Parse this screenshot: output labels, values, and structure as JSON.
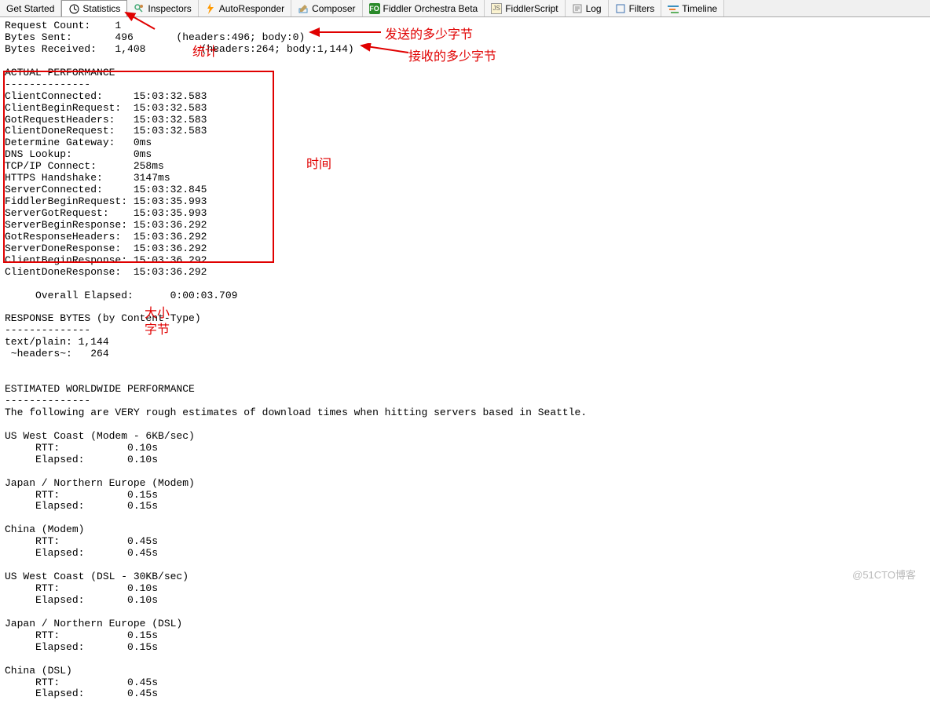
{
  "tabs": {
    "getstarted": "Get Started",
    "statistics": "Statistics",
    "inspectors": "Inspectors",
    "autoresponder": "AutoResponder",
    "composer": "Composer",
    "orchestra": "Fiddler Orchestra Beta",
    "fiddlerscript": "FiddlerScript",
    "log": "Log",
    "filters": "Filters",
    "timeline": "Timeline"
  },
  "stats": {
    "request_count_label": "Request Count:",
    "request_count": "1",
    "bytes_sent_label": "Bytes Sent:",
    "bytes_sent": "496",
    "bytes_sent_detail": "(headers:496; body:0)",
    "bytes_received_label": "Bytes Received:",
    "bytes_received": "1,408",
    "bytes_received_detail": "(headers:264; body:1,144)"
  },
  "actual_performance": {
    "heading": "ACTUAL PERFORMANCE",
    "rows": [
      [
        "ClientConnected:",
        "15:03:32.583"
      ],
      [
        "ClientBeginRequest:",
        "15:03:32.583"
      ],
      [
        "GotRequestHeaders:",
        "15:03:32.583"
      ],
      [
        "ClientDoneRequest:",
        "15:03:32.583"
      ],
      [
        "Determine Gateway:",
        "0ms"
      ],
      [
        "DNS Lookup:",
        "0ms"
      ],
      [
        "TCP/IP Connect:",
        "258ms"
      ],
      [
        "HTTPS Handshake:",
        "3147ms"
      ],
      [
        "ServerConnected:",
        "15:03:32.845"
      ],
      [
        "FiddlerBeginRequest:",
        "15:03:35.993"
      ],
      [
        "ServerGotRequest:",
        "15:03:35.993"
      ],
      [
        "ServerBeginResponse:",
        "15:03:36.292"
      ],
      [
        "GotResponseHeaders:",
        "15:03:36.292"
      ],
      [
        "ServerDoneResponse:",
        "15:03:36.292"
      ],
      [
        "ClientBeginResponse:",
        "15:03:36.292"
      ],
      [
        "ClientDoneResponse:",
        "15:03:36.292"
      ]
    ],
    "overall_label": "Overall Elapsed:",
    "overall_value": "0:00:03.709"
  },
  "response_bytes": {
    "heading": "RESPONSE BYTES (by Content-Type)",
    "textplain": "text/plain: 1,144",
    "headers": " ~headers~:   264"
  },
  "worldwide": {
    "heading": "ESTIMATED WORLDWIDE PERFORMANCE",
    "intro": "The following are VERY rough estimates of download times when hitting servers based in Seattle.",
    "sections": [
      {
        "title": "US West Coast (Modem - 6KB/sec)",
        "rtt": "0.10s",
        "elapsed": "0.10s"
      },
      {
        "title": "Japan / Northern Europe (Modem)",
        "rtt": "0.15s",
        "elapsed": "0.15s"
      },
      {
        "title": "China (Modem)",
        "rtt": "0.45s",
        "elapsed": "0.45s"
      },
      {
        "title": "US West Coast (DSL - 30KB/sec)",
        "rtt": "0.10s",
        "elapsed": "0.10s"
      },
      {
        "title": "Japan / Northern Europe (DSL)",
        "rtt": "0.15s",
        "elapsed": "0.15s"
      },
      {
        "title": "China (DSL)",
        "rtt": "0.45s",
        "elapsed": "0.45s"
      }
    ],
    "rtt_label": "RTT:",
    "elapsed_label": "Elapsed:"
  },
  "annotations": {
    "tongji": "统计",
    "send_bytes": "发送的多少字节",
    "recv_bytes": "接收的多少字节",
    "time": "时间",
    "size1": "大小",
    "size2": "字节"
  },
  "watermark": "@51CTO博客"
}
